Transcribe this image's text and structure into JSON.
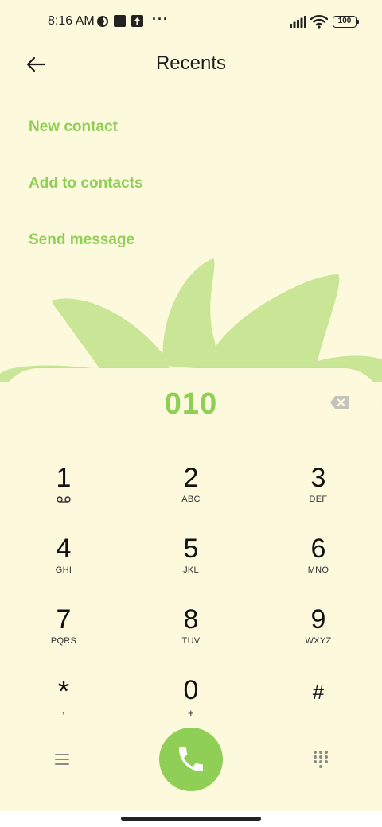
{
  "status_bar": {
    "time": "8:16 AM",
    "dots": "···",
    "battery": "100",
    "icons": [
      "data-saver-icon",
      "square-icon",
      "upload-icon",
      "signal-icon",
      "wifi-icon",
      "battery-icon"
    ]
  },
  "header": {
    "title": "Recents",
    "back_icon": "arrow-left-icon"
  },
  "options": [
    {
      "label": "New contact"
    },
    {
      "label": "Add to contacts"
    },
    {
      "label": "Send message"
    }
  ],
  "dialer": {
    "number": "010",
    "backspace_icon": "backspace-icon",
    "keys": [
      {
        "digit": "1",
        "letters": ""
      },
      {
        "digit": "2",
        "letters": "ABC"
      },
      {
        "digit": "3",
        "letters": "DEF"
      },
      {
        "digit": "4",
        "letters": "GHI"
      },
      {
        "digit": "5",
        "letters": "JKL"
      },
      {
        "digit": "6",
        "letters": "MNO"
      },
      {
        "digit": "7",
        "letters": "PQRS"
      },
      {
        "digit": "8",
        "letters": "TUV"
      },
      {
        "digit": "9",
        "letters": "WXYZ"
      },
      {
        "digit": "*",
        "letters": ","
      },
      {
        "digit": "0",
        "letters": "+"
      },
      {
        "digit": "#",
        "letters": ""
      }
    ],
    "bottom_icons": [
      "menu-icon",
      "phone-icon",
      "dialpad-icon"
    ]
  },
  "colors": {
    "background": "#fdf9dc",
    "accent": "#8fcf56",
    "leaf": "#c9e596"
  }
}
